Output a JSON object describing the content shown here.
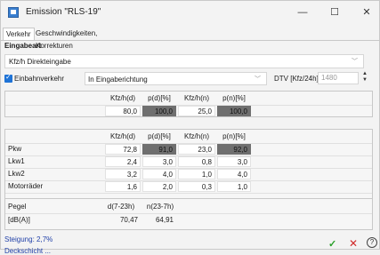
{
  "window": {
    "title": "Emission \"RLS-19\"",
    "min": "—",
    "max": "☐",
    "close": "✕"
  },
  "tabs": [
    {
      "label": "Verkehr"
    },
    {
      "label": "Geschwindigkeiten, Korrekturen"
    }
  ],
  "section": {
    "title": "Eingabeart"
  },
  "input_mode": {
    "value": "Kfz/h Direkteingabe"
  },
  "oneway": {
    "label": "Einbahnverkehr",
    "checked": true,
    "direction": "In Eingaberichtung",
    "dtv_label": "DTV [Kfz/24h]",
    "dtv_value": "1480"
  },
  "table1": {
    "headers": [
      "Kfz/h(d)",
      "p(d)[%]",
      "Kfz/h(n)",
      "p(n)[%]"
    ],
    "row": [
      "80,0",
      "100,0",
      "25,0",
      "100,0"
    ]
  },
  "table2": {
    "headers": [
      "Kfz/h(d)",
      "p(d)[%]",
      "Kfz/h(n)",
      "p(n)[%]"
    ],
    "rows": [
      {
        "label": "Pkw",
        "values": [
          "72,8",
          "91,0",
          "23,0",
          "92,0"
        ]
      },
      {
        "label": "Lkw1",
        "values": [
          "2,4",
          "3,0",
          "0,8",
          "3,0"
        ]
      },
      {
        "label": "Lkw2",
        "values": [
          "3,2",
          "4,0",
          "1,0",
          "4,0"
        ]
      },
      {
        "label": "Motorräder",
        "values": [
          "1,6",
          "2,0",
          "0,3",
          "1,0"
        ]
      }
    ]
  },
  "table3": {
    "label": "Pegel",
    "unit": "[dB(A)]",
    "headers": [
      "d(7-23h)",
      "n(23-7h)"
    ],
    "values": [
      "70,47",
      "64,91"
    ]
  },
  "status": {
    "line1": "Steigung: 2,7%",
    "line2": "Deckschicht ..."
  },
  "icons": {
    "ok": "checkmark-icon",
    "cancel": "close-icon",
    "help": "help-icon"
  }
}
